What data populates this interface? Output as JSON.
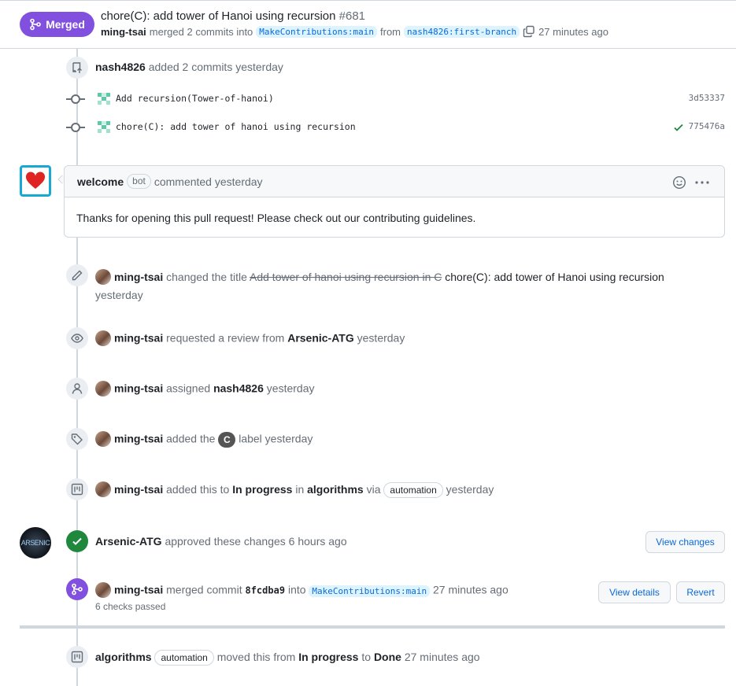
{
  "header": {
    "status_label": "Merged",
    "title": "chore(C): add tower of Hanoi using recursion",
    "number": "#681",
    "merger": "ming-tsai",
    "merged_text": "merged 2 commits into",
    "base_branch": "MakeContributions:main",
    "from_text": "from",
    "head_branch": "nash4826:first-branch",
    "time": "27 minutes ago"
  },
  "commits_event": {
    "user": "nash4826",
    "text": "added 2 commits yesterday",
    "commits": [
      {
        "message": "Add recursion(Tower-of-hanoi)",
        "sha": "3d53337",
        "checked": false
      },
      {
        "message": "chore(C): add tower of hanoi using recursion",
        "sha": "775476a",
        "checked": true
      }
    ]
  },
  "comment": {
    "author": "welcome",
    "bot_label": "bot",
    "meta": "commented yesterday",
    "body": "Thanks for opening this pull request! Please check out our contributing guidelines."
  },
  "events": {
    "title_change": {
      "user": "ming-tsai",
      "text": "changed the title",
      "old_title": "Add tower of hanoi using recursion in C",
      "new_title": "chore(C): add tower of Hanoi using recursion",
      "time": "yesterday"
    },
    "review_request": {
      "user": "ming-tsai",
      "text": "requested a review from",
      "reviewer": "Arsenic-ATG",
      "time": "yesterday"
    },
    "assign": {
      "user": "ming-tsai",
      "text": "assigned",
      "assignee": "nash4826",
      "time": "yesterday"
    },
    "label": {
      "user": "ming-tsai",
      "text_before": "added the",
      "label": "C",
      "text_after": "label yesterday"
    },
    "project": {
      "user": "ming-tsai",
      "text1": "added this to",
      "column": "In progress",
      "text2": "in",
      "project": "algorithms",
      "text3": "via",
      "automation": "automation",
      "time": "yesterday"
    },
    "approval": {
      "user": "Arsenic-ATG",
      "text": "approved these changes 6 hours ago",
      "button": "View changes",
      "avatar_text": "ARSENIC"
    },
    "merge": {
      "user": "ming-tsai",
      "text": "merged commit",
      "commit": "8fcdba9",
      "into": "into",
      "branch": "MakeContributions:main",
      "time": "27 minutes ago",
      "checks": "6 checks passed",
      "btn_details": "View details",
      "btn_revert": "Revert"
    },
    "moved": {
      "project": "algorithms",
      "automation": "automation",
      "text1": "moved this from",
      "from": "In progress",
      "text2": "to",
      "to": "Done",
      "time": "27 minutes ago"
    }
  }
}
